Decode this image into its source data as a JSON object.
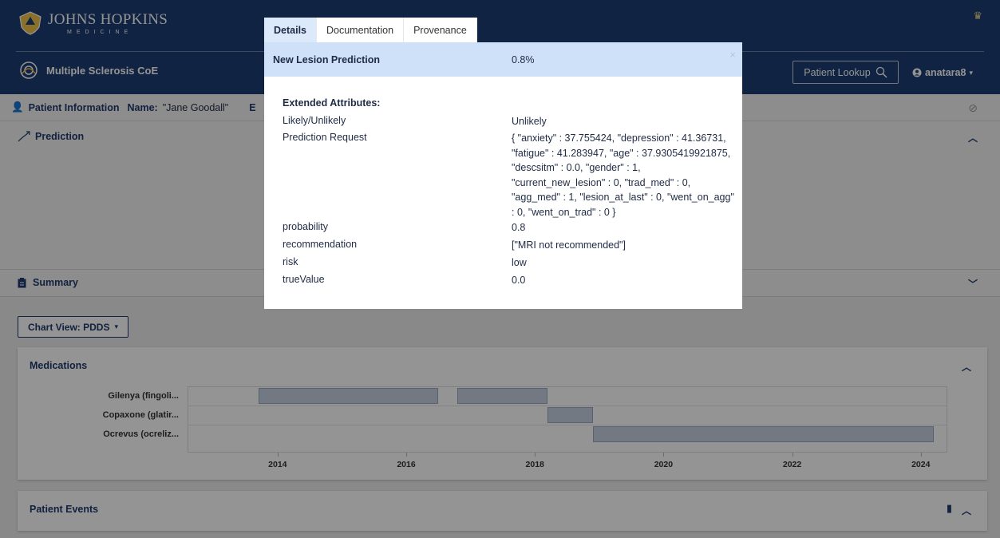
{
  "header": {
    "brand_name": "JOHNS HOPKINS",
    "brand_sub": "MEDICINE",
    "app_name": "Multiple Sclerosis CoE",
    "lookup_label": "Patient Lookup",
    "user_label": "anatara8"
  },
  "patient_info": {
    "label": "Patient Information",
    "name_label": "Name:",
    "name_value": "\"Jane Goodall\"",
    "trailing": "E"
  },
  "prediction": {
    "title": "Prediction"
  },
  "summary": {
    "title": "Summary"
  },
  "chart_view": {
    "label": "Chart View: PDDS"
  },
  "medications": {
    "title": "Medications",
    "chart_data": {
      "type": "gantt",
      "categories": [
        "Gilenya (fingoli...",
        "Copaxone (glatir...",
        "Ocrevus (ocreliz..."
      ],
      "bars": [
        {
          "row": 0,
          "start": 2013.7,
          "end": 2016.5
        },
        {
          "row": 0,
          "start": 2016.8,
          "end": 2018.2
        },
        {
          "row": 1,
          "start": 2018.2,
          "end": 2018.9
        },
        {
          "row": 2,
          "start": 2018.9,
          "end": 2024.2
        }
      ],
      "xlim": [
        2012.6,
        2024.4
      ],
      "x_ticks": [
        "2014",
        "2016",
        "2018",
        "2020",
        "2022",
        "2024"
      ]
    }
  },
  "patient_events": {
    "title": "Patient Events"
  },
  "modal": {
    "tabs": [
      "Details",
      "Documentation",
      "Provenance"
    ],
    "active_tab": "Details",
    "header_title": "New Lesion Prediction",
    "header_value": "0.8%",
    "close_label": "×",
    "ext_title": "Extended Attributes:",
    "attributes": [
      {
        "key": "Likely/Unlikely",
        "value": "Unlikely"
      },
      {
        "key": "Prediction Request",
        "value": "{ \"anxiety\" : 37.755424, \"depression\" : 41.36731, \"fatigue\" : 41.283947, \"age\" : 37.9305419921875, \"descsitm\" : 0.0, \"gender\" : 1, \"current_new_lesion\" : 0, \"trad_med\" : 0, \"agg_med\" : 1, \"lesion_at_last\" : 0, \"went_on_agg\" : 0, \"went_on_trad\" : 0 }"
      },
      {
        "key": "probability",
        "value": "0.8"
      },
      {
        "key": "recommendation",
        "value": "[\"MRI not recommended\"]"
      },
      {
        "key": "risk",
        "value": "low"
      },
      {
        "key": "trueValue",
        "value": "0.0"
      }
    ]
  }
}
